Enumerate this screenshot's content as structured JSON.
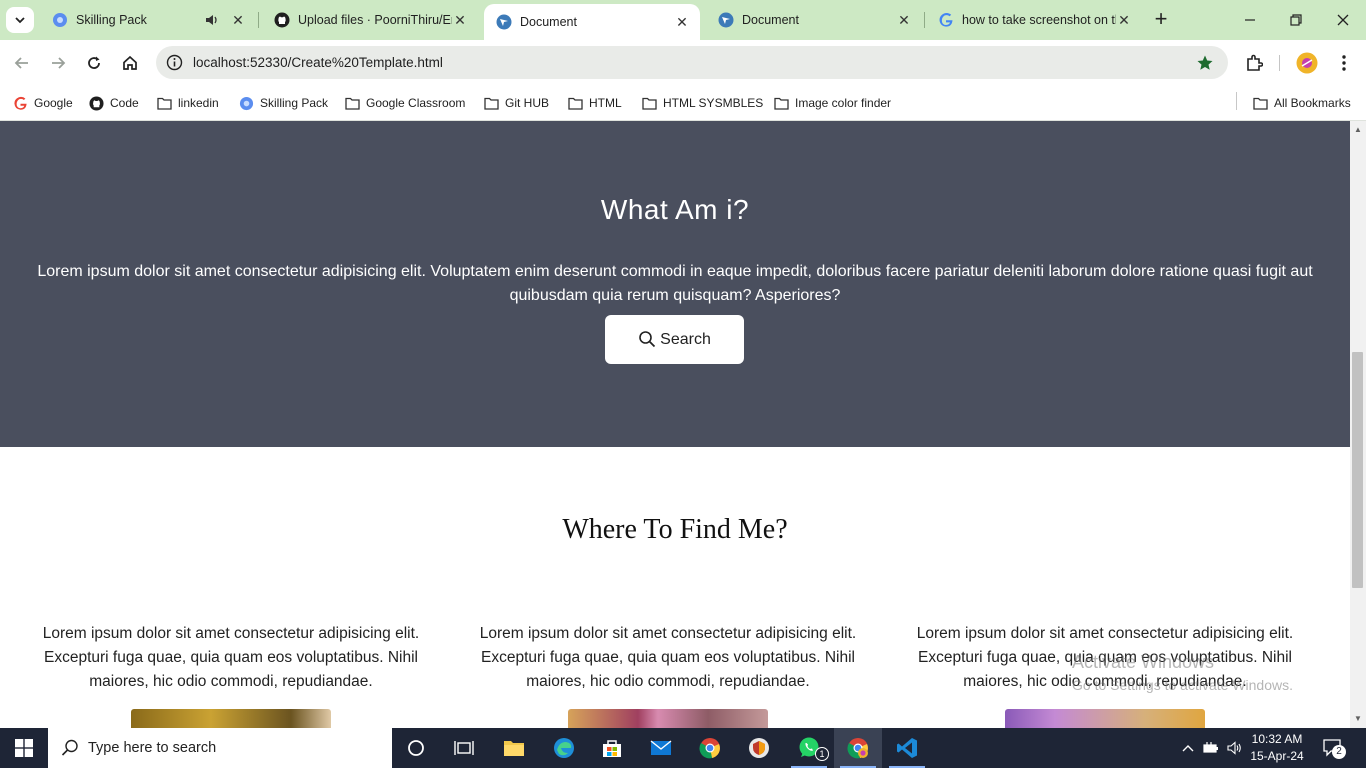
{
  "browser": {
    "tabs": [
      {
        "title": "Skilling Pack",
        "active": false
      },
      {
        "title": "Upload files · PoorniThiru/En",
        "active": false
      },
      {
        "title": "Document",
        "active": true
      },
      {
        "title": "Document",
        "active": false
      },
      {
        "title": "how to take screenshot on th",
        "active": false
      }
    ],
    "url": "localhost:52330/Create%20Template.html",
    "bookmarks": [
      "Google",
      "Code",
      "linkedin",
      "Skilling Pack",
      "Google Classroom",
      "Git HUB",
      "HTML",
      "HTML SYSMBLES",
      "Image color finder"
    ],
    "all_bookmarks": "All Bookmarks"
  },
  "page": {
    "hero_title": "What Am i?",
    "hero_text": "Lorem ipsum dolor sit amet consectetur adipisicing elit. Voluptatem enim deserunt commodi in eaque impedit, doloribus facere pariatur deleniti laborum dolore ratione quasi fugit aut quibusdam quia rerum quisquam? Asperiores?",
    "search_label": "Search",
    "find_title": "Where To Find Me?",
    "columns": [
      "Lorem ipsum dolor sit amet consectetur adipisicing elit. Excepturi fuga quae, quia quam eos voluptatibus. Nihil maiores, hic odio commodi, repudiandae.",
      "Lorem ipsum dolor sit amet consectetur adipisicing elit. Excepturi fuga quae, quia quam eos voluptatibus. Nihil maiores, hic odio commodi, repudiandae.",
      "Lorem ipsum dolor sit amet consectetur adipisicing elit. Excepturi fuga quae, quia quam eos voluptatibus. Nihil maiores, hic odio commodi, repudiandae."
    ],
    "hero_color": "#4a4f5e"
  },
  "watermark": {
    "line1": "Activate Windows",
    "line2": "Go to Settings to activate Windows."
  },
  "taskbar": {
    "search_placeholder": "Type here to search",
    "time": "10:32 AM",
    "date": "15-Apr-24",
    "whatsapp_badge": "1",
    "notification_count": "2"
  }
}
